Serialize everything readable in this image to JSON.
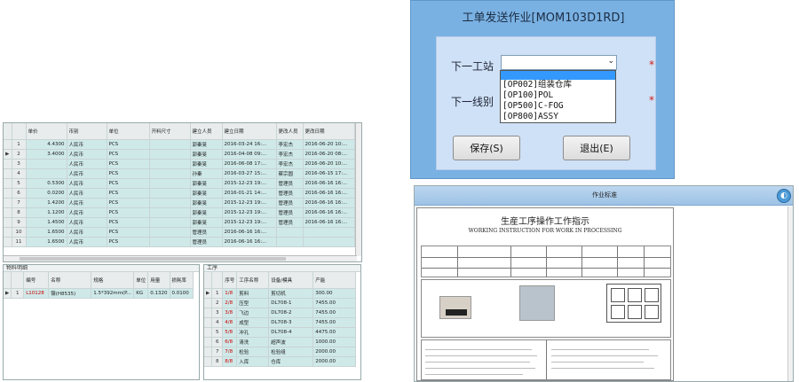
{
  "main_grid": {
    "columns": [
      "",
      "单价",
      "币别",
      "单位",
      "开料尺寸",
      "建立人员",
      "建立日期",
      "更改人员",
      "更改日期"
    ],
    "rows": [
      {
        "n": "1",
        "price": "4.4300",
        "cur": "人民币",
        "unit": "PCS",
        "size": "",
        "creator": "郭秦旻",
        "created": "2016-03-24 16:...",
        "modifier": "李宏杰",
        "modified": "2016-06-20 10:..."
      },
      {
        "n": "2",
        "price": "3.4000",
        "cur": "人民币",
        "unit": "PCS",
        "size": "",
        "creator": "郭秦旻",
        "created": "2016-04-08 09:...",
        "modifier": "李宏杰",
        "modified": "2016-06-20 08:..."
      },
      {
        "n": "3",
        "price": "",
        "cur": "人民币",
        "unit": "PCS",
        "size": "",
        "creator": "郭秦旻",
        "created": "2016-06-08 17:...",
        "modifier": "李宏杰",
        "modified": "2016-06-20 10:..."
      },
      {
        "n": "4",
        "price": "",
        "cur": "人民币",
        "unit": "PCS",
        "size": "",
        "creator": "孙秦",
        "created": "2016-03-27 15:...",
        "modifier": "蔡宗圆",
        "modified": "2016-06-15 17:..."
      },
      {
        "n": "5",
        "price": "0.5300",
        "cur": "人民币",
        "unit": "PCS",
        "size": "",
        "creator": "郭秦旻",
        "created": "2015-12-23 19:...",
        "modifier": "管理员",
        "modified": "2016-06-16 16:..."
      },
      {
        "n": "6",
        "price": "0.0200",
        "cur": "人民币",
        "unit": "PCS",
        "size": "",
        "creator": "郭秦旻",
        "created": "2016-01-21 14:...",
        "modifier": "管理员",
        "modified": "2016-06-16 16:..."
      },
      {
        "n": "7",
        "price": "1.4200",
        "cur": "人民币",
        "unit": "PCS",
        "size": "",
        "creator": "郭秦旻",
        "created": "2015-12-23 19:...",
        "modifier": "管理员",
        "modified": "2016-06-16 16:..."
      },
      {
        "n": "8",
        "price": "1.1200",
        "cur": "人民币",
        "unit": "PCS",
        "size": "",
        "creator": "郭秦旻",
        "created": "2015-12-23 19:...",
        "modifier": "管理员",
        "modified": "2016-06-16 16:..."
      },
      {
        "n": "9",
        "price": "1.4500",
        "cur": "人民币",
        "unit": "PCS",
        "size": "",
        "creator": "郭秦旻",
        "created": "2015-12-23 19:...",
        "modifier": "管理员",
        "modified": "2016-06-16 16:..."
      },
      {
        "n": "10",
        "price": "1.6500",
        "cur": "人民币",
        "unit": "PCS",
        "size": "",
        "creator": "管理员",
        "created": "2016-06-16 16:...",
        "modifier": "",
        "modified": ""
      },
      {
        "n": "11",
        "price": "1.6500",
        "cur": "人民币",
        "unit": "PCS",
        "size": "",
        "creator": "管理员",
        "created": "2016-06-16 16:...",
        "modifier": "",
        "modified": ""
      }
    ]
  },
  "material_panel": {
    "title": "物料明细",
    "columns": [
      "",
      "编号",
      "名称",
      "规格",
      "单位",
      "用量",
      "损耗率"
    ],
    "row": {
      "n": "1",
      "code": "L10128",
      "name": "镍(H8535)",
      "spec": "1.5*392mm(P...",
      "unit": "KG",
      "qty": "0.1320",
      "loss": "0.0100"
    }
  },
  "process_panel": {
    "title": "工序",
    "columns": [
      "",
      "序号",
      "工序名称",
      "设备/模具",
      "产能"
    ],
    "rows": [
      {
        "n": "1",
        "seq": "1/8",
        "name": "剪料",
        "equip": "剪切机",
        "cap": "300.00"
      },
      {
        "n": "2",
        "seq": "2/8",
        "name": "压型",
        "equip": "DL708-1",
        "cap": "7455.00"
      },
      {
        "n": "3",
        "seq": "3/8",
        "name": "飞边",
        "equip": "DL708-2",
        "cap": "7455.00"
      },
      {
        "n": "4",
        "seq": "4/8",
        "name": "成型",
        "equip": "DL708-3",
        "cap": "7455.00"
      },
      {
        "n": "5",
        "seq": "5/8",
        "name": "冲孔",
        "equip": "DL708-4",
        "cap": "4475.00"
      },
      {
        "n": "6",
        "seq": "6/8",
        "name": "清洗",
        "equip": "超声波",
        "cap": "1000.00"
      },
      {
        "n": "7",
        "seq": "7/8",
        "name": "检验",
        "equip": "检验组",
        "cap": "2000.00"
      },
      {
        "n": "8",
        "seq": "8/8",
        "name": "入库",
        "equip": "仓库",
        "cap": "2000.00"
      }
    ]
  },
  "dialog": {
    "title": "工单发送作业[MOM103D1RD]",
    "next_station_label": "下一工站",
    "next_line_label": "下一线别",
    "star": "*",
    "arrow": "⌄",
    "options": [
      "[OP002]组装仓库",
      "[OP100]POL",
      "[OP500]C-FOG",
      "[OP800]ASSY"
    ],
    "save": "保存(S)",
    "exit": "退出(E)"
  },
  "work_standard": {
    "title": "作业标准",
    "doc_title": "生産工序操作工作指示",
    "doc_subtitle": "WORKING INSTRUCTION FOR WORK IN PROCESSING",
    "btn_icon": "◐"
  }
}
